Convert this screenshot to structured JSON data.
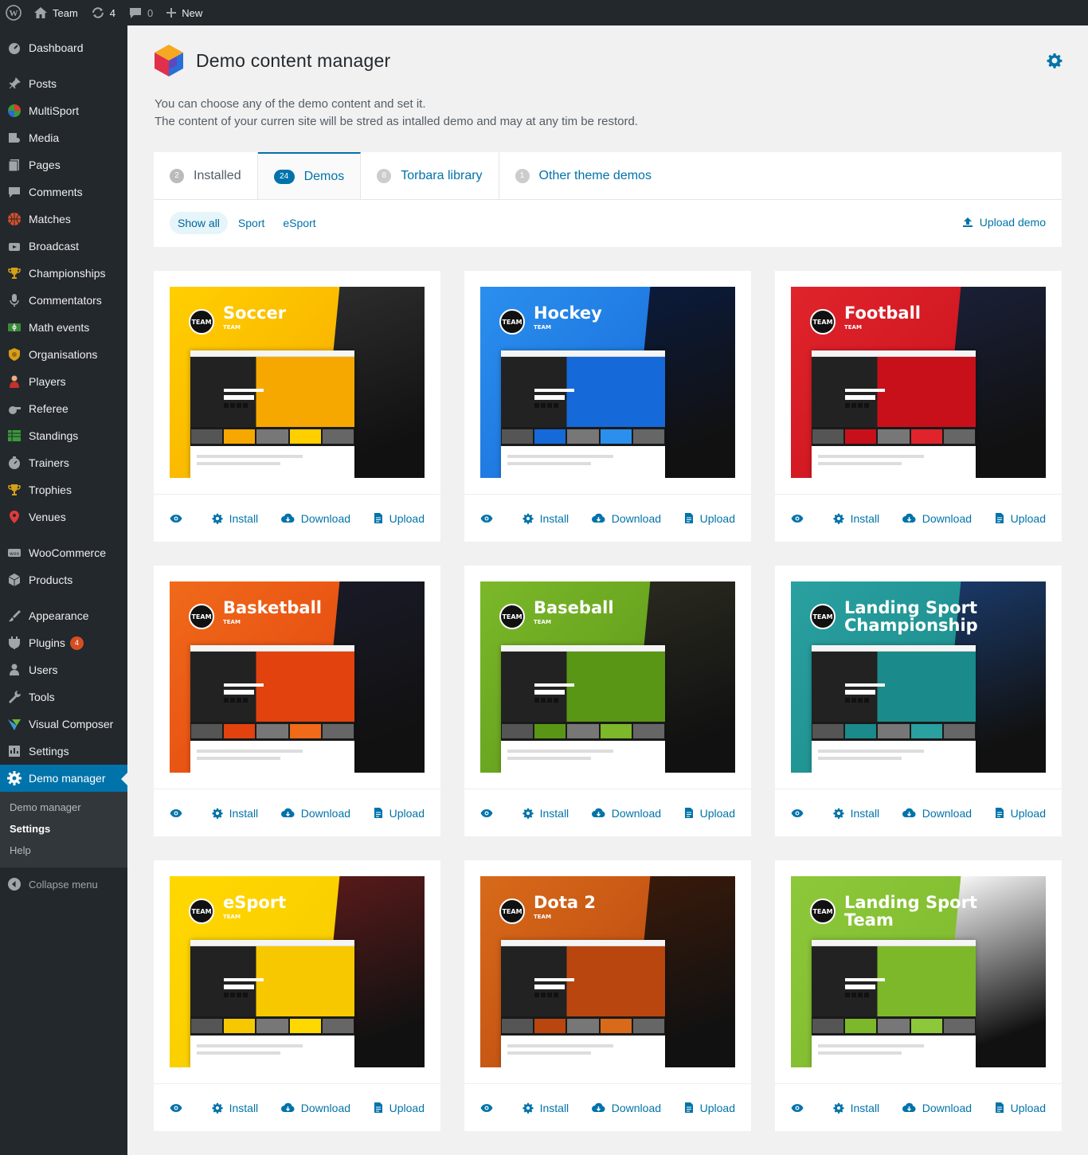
{
  "adminbar": {
    "site_name": "Team",
    "updates_count": "4",
    "comments_count": "0",
    "new_label": "New"
  },
  "sidebar": {
    "items": [
      {
        "label": "Dashboard",
        "icon": "dashboard-icon"
      },
      {
        "label": "Posts",
        "icon": "pin-icon"
      },
      {
        "label": "MultiSport",
        "icon": "multisport-icon"
      },
      {
        "label": "Media",
        "icon": "media-icon"
      },
      {
        "label": "Pages",
        "icon": "pages-icon"
      },
      {
        "label": "Comments",
        "icon": "comments-icon"
      },
      {
        "label": "Matches",
        "icon": "basketball-icon"
      },
      {
        "label": "Broadcast",
        "icon": "broadcast-icon"
      },
      {
        "label": "Championships",
        "icon": "trophy-icon"
      },
      {
        "label": "Commentators",
        "icon": "microphone-icon"
      },
      {
        "label": "Math events",
        "icon": "field-icon"
      },
      {
        "label": "Organisations",
        "icon": "shield-icon"
      },
      {
        "label": "Players",
        "icon": "player-icon"
      },
      {
        "label": "Referee",
        "icon": "whistle-icon"
      },
      {
        "label": "Standings",
        "icon": "table-icon"
      },
      {
        "label": "Trainers",
        "icon": "stopwatch-icon"
      },
      {
        "label": "Trophies",
        "icon": "trophy-icon"
      },
      {
        "label": "Venues",
        "icon": "location-pin-icon"
      },
      {
        "label": "WooCommerce",
        "icon": "woo-icon"
      },
      {
        "label": "Products",
        "icon": "products-icon"
      },
      {
        "label": "Appearance",
        "icon": "brush-icon"
      },
      {
        "label": "Plugins",
        "icon": "plugins-icon",
        "badge": "4"
      },
      {
        "label": "Users",
        "icon": "users-icon"
      },
      {
        "label": "Tools",
        "icon": "tools-icon"
      },
      {
        "label": "Visual Composer",
        "icon": "visual-composer-icon"
      },
      {
        "label": "Settings",
        "icon": "settings-icon"
      },
      {
        "label": "Demo manager",
        "icon": "gear-icon"
      }
    ],
    "submenu": [
      "Demo manager",
      "Settings",
      "Help"
    ],
    "collapse_label": "Collapse menu"
  },
  "page": {
    "title": "Demo content manager",
    "intro_line1": "You can choose any of the demo content and set it.",
    "intro_line2": "The content of your curren site will be stred as intalled demo and may at any tim be restord."
  },
  "tabs": [
    {
      "count": "2",
      "label": "Installed"
    },
    {
      "count": "24",
      "label": "Demos"
    },
    {
      "count": "8",
      "label": "Torbara library"
    },
    {
      "count": "1",
      "label": "Other theme demos"
    }
  ],
  "filters": [
    "Show all",
    "Sport",
    "eSport"
  ],
  "upload_demo_label": "Upload demo",
  "card_actions": {
    "install": "Install",
    "download": "Download",
    "upload": "Upload"
  },
  "demos": [
    {
      "title": "Soccer",
      "subtitle": "TEAM",
      "badge": "TEAM",
      "colors": [
        "#f7a800",
        "#ffcf00",
        "#2d2d2d"
      ]
    },
    {
      "title": "Hockey",
      "subtitle": "TEAM",
      "badge": "TEAM",
      "colors": [
        "#1669d8",
        "#2b8fee",
        "#0b1b3c"
      ]
    },
    {
      "title": "Football",
      "subtitle": "TEAM",
      "badge": "TEAM",
      "colors": [
        "#c8101a",
        "#e0242c",
        "#1a2038"
      ]
    },
    {
      "title": "Basketball",
      "subtitle": "TEAM",
      "badge": "TEAM",
      "colors": [
        "#e2420e",
        "#f06a1a",
        "#1a1a28"
      ]
    },
    {
      "title": "Baseball",
      "subtitle": "TEAM",
      "badge": "TEAM",
      "colors": [
        "#5a9616",
        "#7cb82a",
        "#2a2a20"
      ]
    },
    {
      "title": "Landing Sport Championship",
      "subtitle": "",
      "badge": "TEAM",
      "colors": [
        "#1a8a8a",
        "#2aa0a0",
        "#1a3a6a"
      ]
    },
    {
      "title": "eSport",
      "subtitle": "TEAM",
      "badge": "TEAM",
      "colors": [
        "#f7c800",
        "#ffd800",
        "#5a1a1a"
      ]
    },
    {
      "title": "Dota 2",
      "subtitle": "TEAM",
      "badge": "TEAM",
      "colors": [
        "#b8460e",
        "#d86a1a",
        "#3a1a0a"
      ]
    },
    {
      "title": "Landing Sport Team",
      "subtitle": "",
      "badge": "TEAM",
      "colors": [
        "#7cb82a",
        "#8cc83a",
        "#ffffff"
      ]
    }
  ],
  "accent_color": "#0073aa"
}
